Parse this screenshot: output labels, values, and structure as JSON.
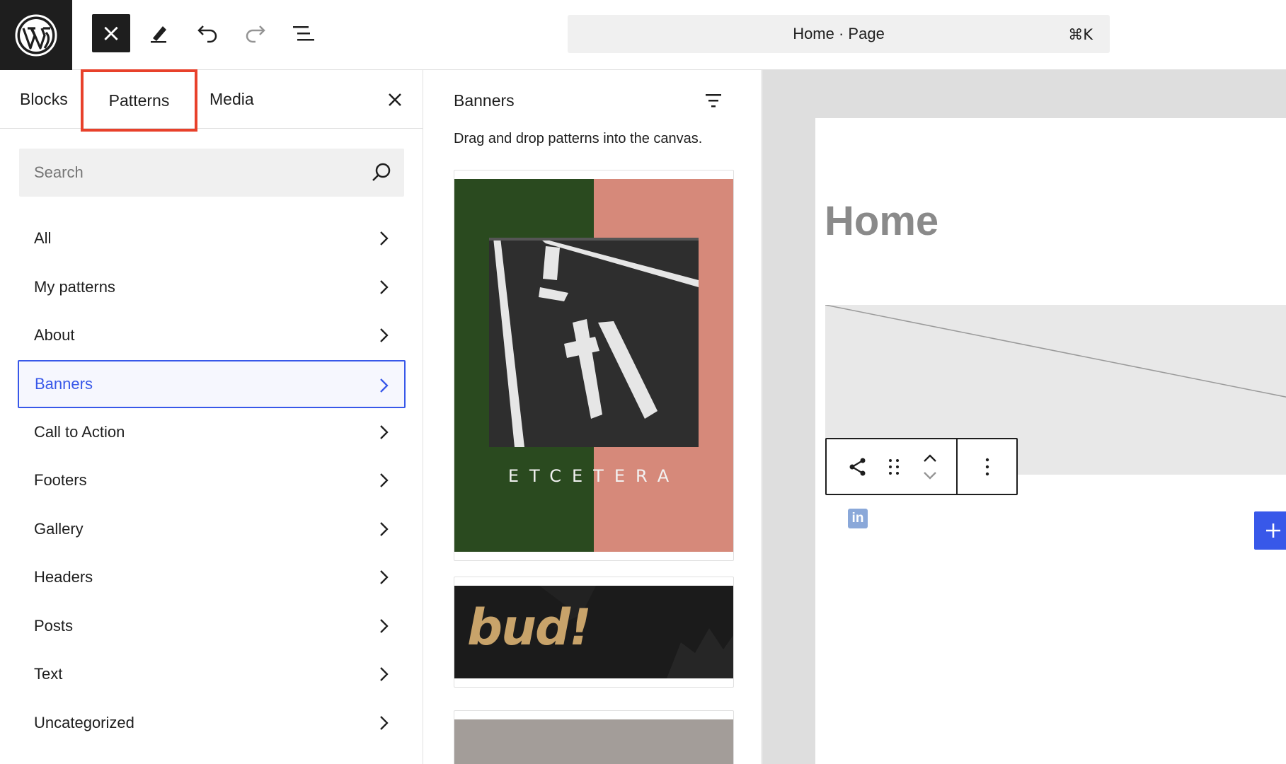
{
  "toolbar": {
    "close_label": "×",
    "command_bar": {
      "label": "Home · Page",
      "shortcut": "⌘K"
    }
  },
  "inserter": {
    "tabs": [
      {
        "label": "Blocks"
      },
      {
        "label": "Patterns"
      },
      {
        "label": "Media"
      }
    ],
    "search": {
      "placeholder": "Search"
    },
    "categories": [
      {
        "label": "All"
      },
      {
        "label": "My patterns"
      },
      {
        "label": "About"
      },
      {
        "label": "Banners"
      },
      {
        "label": "Call to Action"
      },
      {
        "label": "Footers"
      },
      {
        "label": "Gallery"
      },
      {
        "label": "Headers"
      },
      {
        "label": "Posts"
      },
      {
        "label": "Text"
      },
      {
        "label": "Uncategorized"
      }
    ],
    "active_category": "Banners"
  },
  "patterns": {
    "title": "Banners",
    "description": "Drag and drop patterns into the canvas.",
    "cards": [
      {
        "caption": "ETCETERA",
        "colors": [
          "#2a4a1f",
          "#d6897a"
        ]
      },
      {
        "caption": "bud!",
        "colors": [
          "#1b1b1b",
          "#c8a36a"
        ]
      },
      {
        "colors": [
          "#a39d99"
        ]
      }
    ]
  },
  "canvas": {
    "page_title": "Home",
    "social_icon": "in",
    "accent": "#3858e9"
  }
}
